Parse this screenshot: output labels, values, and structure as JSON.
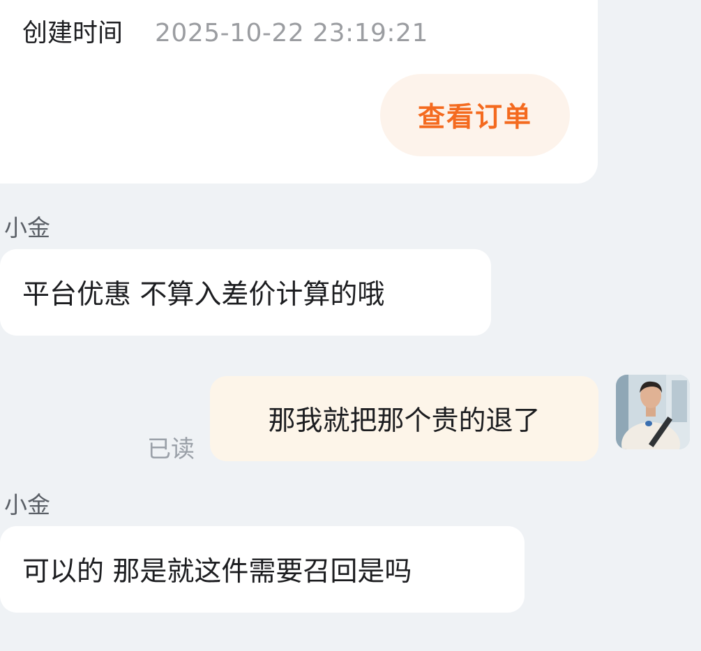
{
  "order_card": {
    "created_label": "创建时间",
    "created_time": "2025-10-22 23:19:21",
    "view_order_label": "查看订单"
  },
  "messages": [
    {
      "sender": "小金",
      "text": "平台优惠 不算入差价计算的哦"
    },
    {
      "text": "那我就把那个贵的退了",
      "status": "已读"
    },
    {
      "sender": "小金",
      "text": "可以的 那是就这件需要召回是吗"
    }
  ],
  "colors": {
    "page_background": "#eff2f5",
    "incoming_bubble": "#ffffff",
    "outgoing_bubble": "#fdf5e9",
    "accent_orange": "#f46a1f",
    "view_order_bg": "#fdf3eb"
  }
}
